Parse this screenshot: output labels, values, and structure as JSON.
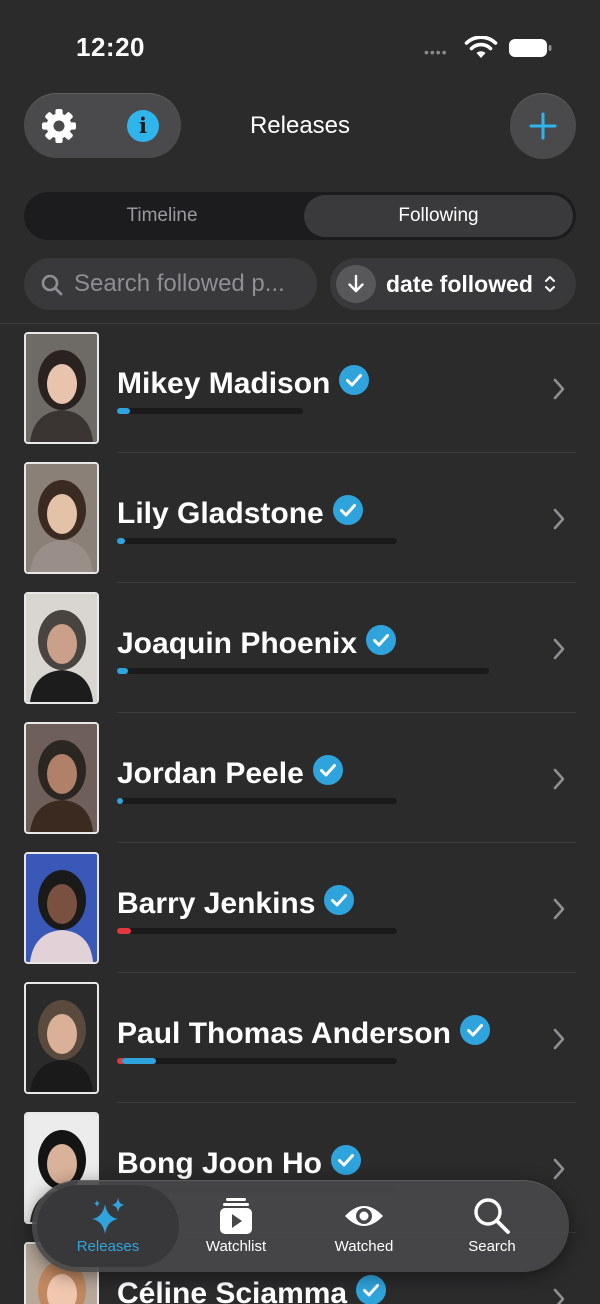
{
  "status_bar": {
    "time": "12:20",
    "signal_dots": "••••"
  },
  "header": {
    "title": "Releases",
    "info_glyph": "i"
  },
  "segmented": {
    "items": [
      {
        "label": "Timeline",
        "selected": false
      },
      {
        "label": "Following",
        "selected": true
      }
    ]
  },
  "search": {
    "placeholder": "Search followed p..."
  },
  "sort": {
    "label": "date followed",
    "direction": "descending"
  },
  "people": [
    {
      "name": "Mikey Madison",
      "verified": true,
      "progress_blue": 0.07,
      "progress_red": 0
    },
    {
      "name": "Lily Gladstone",
      "verified": true,
      "progress_blue": 0.03,
      "progress_red": 0
    },
    {
      "name": "Joaquin Phoenix",
      "verified": true,
      "progress_blue": 0.03,
      "progress_red": 0
    },
    {
      "name": "Jordan Peele",
      "verified": true,
      "progress_blue": 0.02,
      "progress_red": 0
    },
    {
      "name": "Barry Jenkins",
      "verified": true,
      "progress_blue": 0,
      "progress_red": 0.05
    },
    {
      "name": "Paul Thomas Anderson",
      "verified": true,
      "progress_blue": 0.12,
      "progress_red": 0.03
    },
    {
      "name": "Bong Joon Ho",
      "verified": true,
      "progress_blue": 0.05,
      "progress_red": 0
    },
    {
      "name": "Céline Sciamma",
      "verified": true,
      "progress_blue": 0.04,
      "progress_red": 0
    }
  ],
  "tab_bar": {
    "tabs": [
      {
        "label": "Releases",
        "icon": "sparkles-icon",
        "active": true
      },
      {
        "label": "Watchlist",
        "icon": "play-stack-icon",
        "active": false
      },
      {
        "label": "Watched",
        "icon": "eye-icon",
        "active": false
      },
      {
        "label": "Search",
        "icon": "search-icon",
        "active": false
      }
    ]
  },
  "colors": {
    "accent": "#2fa4dc",
    "info": "#2fb4ec",
    "danger": "#e0383e",
    "background": "#2b2b2c"
  }
}
